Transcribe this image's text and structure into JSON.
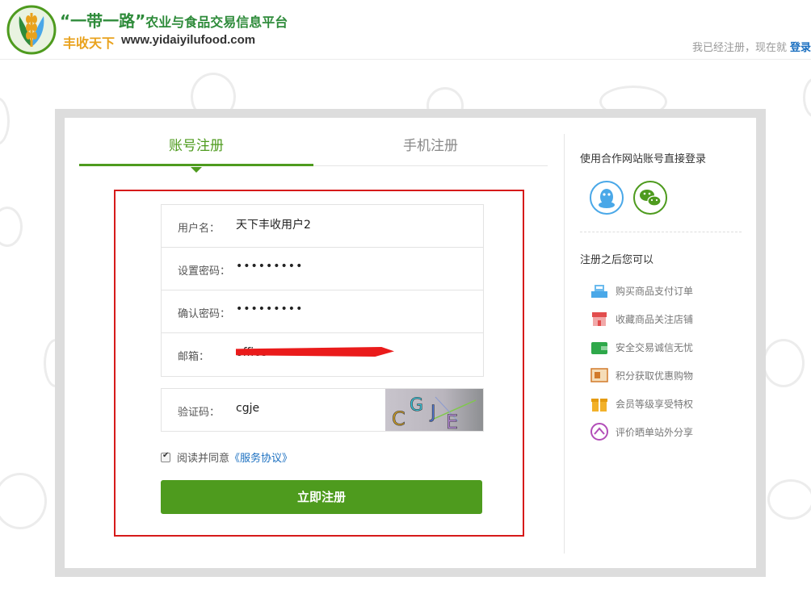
{
  "header": {
    "logo_title": "“一带一路”",
    "logo_subtitle": "农业与食品交易信息平台",
    "logo_cn": "丰收天下",
    "logo_url": "www.yidaiyilufood.com",
    "login_prompt": "我已经注册，现在就",
    "login_link": "登录"
  },
  "tabs": [
    {
      "label": "账号注册",
      "active": true
    },
    {
      "label": "手机注册",
      "active": false
    }
  ],
  "form": {
    "username_label": "用户名：",
    "username_value": "天下丰收用户2",
    "password_label": "设置密码：",
    "password_value": "•••••••••",
    "confirm_label": "确认密码：",
    "confirm_value": "•••••••••",
    "email_label": "邮箱：",
    "email_value": "office",
    "captcha_label": "验证码：",
    "captcha_value": "cgje",
    "captcha_image_text": "CGJE",
    "agree_text": "阅读并同意",
    "agree_link": "《服务协议》",
    "agree_checked": true,
    "submit_label": "立即注册"
  },
  "side": {
    "partner_title": "使用合作网站账号直接登录",
    "partners": [
      "qq-icon",
      "wechat-icon"
    ],
    "after_title": "注册之后您可以",
    "benefits": [
      {
        "label": "购买商品支付订单",
        "icon": "cashier-icon"
      },
      {
        "label": "收藏商品关注店铺",
        "icon": "store-icon"
      },
      {
        "label": "安全交易诚信无忧",
        "icon": "wallet-icon"
      },
      {
        "label": "积分获取优惠购物",
        "icon": "gift-card-icon"
      },
      {
        "label": "会员等级享受特权",
        "icon": "gift-box-icon"
      },
      {
        "label": "评价晒单站外分享",
        "icon": "share-icon"
      }
    ]
  },
  "colors": {
    "brand_green": "#4e9b1e",
    "link_blue": "#1a6fc0",
    "highlight_red": "#d61a1a"
  }
}
